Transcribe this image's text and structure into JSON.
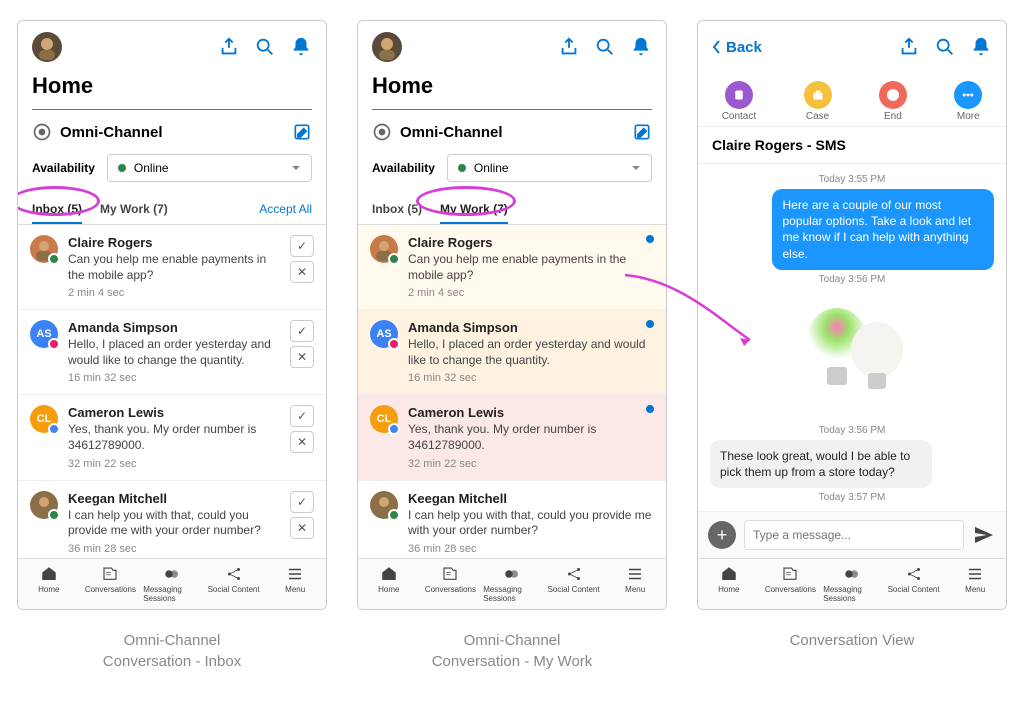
{
  "captions": {
    "inbox": "Omni-Channel\nConversation - Inbox",
    "mywork": "Omni-Channel\nConversation - My Work",
    "conv": "Conversation View"
  },
  "header": {
    "home_title": "Home",
    "back_label": "Back"
  },
  "omni": {
    "title": "Omni-Channel",
    "availability_label": "Availability",
    "status": "Online"
  },
  "tabs": {
    "inbox": "Inbox (5)",
    "mywork": "My Work (7)",
    "accept_all": "Accept All"
  },
  "people": [
    {
      "name": "Claire Rogers",
      "msg": "Can you help me enable payments in the mobile app?",
      "time": "2 min 4 sec",
      "initials": "",
      "avatar_color": "#c97a4a",
      "avatar_type": "photo",
      "badge_color": "#2e844a"
    },
    {
      "name": "Amanda Simpson",
      "msg": "Hello, I placed an order yesterday and would like to change the quantity.",
      "time": "16 min 32 sec",
      "initials": "AS",
      "avatar_color": "#3b82f6",
      "avatar_type": "initials",
      "badge_color": "#e91e63"
    },
    {
      "name": "Cameron Lewis",
      "msg": "Yes, thank you. My order number is 34612789000.",
      "time": "32 min 22 sec",
      "initials": "CL",
      "avatar_color": "#f59e0b",
      "avatar_type": "initials",
      "badge_color": "#4285f4"
    },
    {
      "name": "Keegan Mitchell",
      "msg": "I can help you with that, could you provide me with your order number?",
      "time": "36 min 28 sec",
      "initials": "",
      "avatar_color": "#8b6f47",
      "avatar_type": "photo",
      "badge_color": "#2e844a"
    }
  ],
  "footer": {
    "items": [
      "Home",
      "Conversations",
      "Messaging Sessions",
      "Social Content",
      "Menu"
    ]
  },
  "conversation": {
    "title": "Claire Rogers - SMS",
    "actions": [
      {
        "label": "Contact",
        "color": "#9b59d0"
      },
      {
        "label": "Case",
        "color": "#f5c13c"
      },
      {
        "label": "End",
        "color": "#ef6a5a"
      },
      {
        "label": "More",
        "color": "#1b96ff"
      }
    ],
    "timeline": [
      {
        "type": "ts",
        "text": "Today 3:55 PM"
      },
      {
        "type": "out",
        "text": "Here are a couple of our most popular options. Take a look and let me know if I can help with anything else."
      },
      {
        "type": "ts",
        "text": "Today 3:56 PM"
      },
      {
        "type": "image"
      },
      {
        "type": "ts",
        "text": "Today 3:56 PM"
      },
      {
        "type": "in",
        "text": "These look great, would I be able to pick them up from a store today?"
      },
      {
        "type": "ts",
        "text": "Today 3:57 PM"
      }
    ],
    "composer_placeholder": "Type a message..."
  }
}
